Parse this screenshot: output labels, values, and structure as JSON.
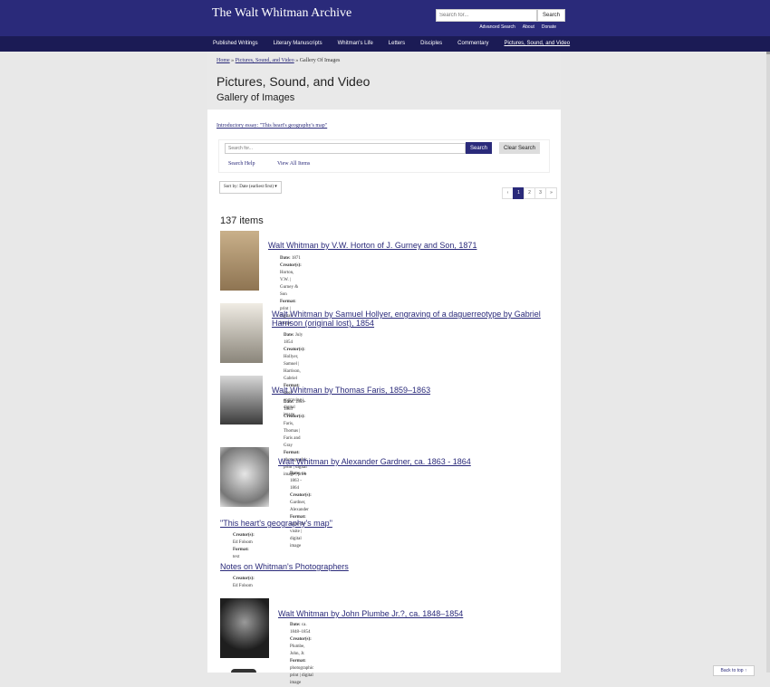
{
  "header": {
    "site_title": "The Walt Whitman Archive",
    "search_placeholder": "Search for...",
    "search_button": "Search",
    "links": [
      "Advanced Search",
      "About",
      "Donate"
    ]
  },
  "nav": {
    "items": [
      "Published Writings",
      "Literary Manuscripts",
      "Whitman's Life",
      "Letters",
      "Disciples",
      "Commentary",
      "Pictures, Sound, and Video"
    ]
  },
  "breadcrumb": {
    "home": "Home",
    "section": "Pictures, Sound, and Video",
    "current": "Gallery Of Images",
    "sep": "»"
  },
  "page": {
    "title": "Pictures, Sound, and Video",
    "subtitle": "Gallery of Images",
    "intro_link": "Introductory essay: \"This heart's geography's map\""
  },
  "search": {
    "placeholder": "Search for...",
    "search_button": "Search",
    "clear_button": "Clear Search",
    "help_link": "Search Help",
    "view_all_link": "View All Items"
  },
  "sort": {
    "label": "Sort by: Date (earliest first) ▾"
  },
  "pagination": {
    "prev": "‹",
    "pages": [
      "1",
      "2",
      "3"
    ],
    "next": "»"
  },
  "results": {
    "count": "137 items",
    "items": [
      {
        "title": "Walt Whitman by V.W. Horton of J. Gurney and Son, 1871",
        "date": "1871",
        "creator": "Horton, V.W. | Gurney & Son",
        "format": "print | digital image"
      },
      {
        "title": "Walt Whitman by Samuel Hollyer, engraving of a daguerreotype by Gabriel Harrison (original lost), 1854",
        "date": "July 1854",
        "creator": "Hollyer, Samuel | Harrison, Gabriel",
        "format": "steel engraving | digital image"
      },
      {
        "title": "Walt Whitman by Thomas Faris, 1859–1863",
        "date": "1859-1863",
        "creator": "Faris, Thomas | Faris and Gray",
        "format": "photographic print | digital image | print"
      },
      {
        "title": "Walt Whitman by Alexander Gardner, ca. 1863 - 1864",
        "date": "ca. 1863 - 1864",
        "creator": "Gardner, Alexander",
        "format": "carte-de-visite | digital image"
      },
      {
        "title": "\"This heart's geography's map\"",
        "creator": "Ed Folsom",
        "format": "text"
      },
      {
        "title": "Notes on Whitman's Photographers",
        "creator": "Ed Folsom"
      },
      {
        "title": "Walt Whitman by John Plumbe Jr.?, ca. 1848–1854",
        "date": "ca. 1848–1854",
        "creator": "Plumbe, John, Jr.",
        "format": "photographic print | digital image"
      }
    ]
  },
  "labels": {
    "date": "Date:",
    "creator": "Creator(s):",
    "format": "Format:"
  },
  "back_to_top": "Back to top ↑",
  "colors": {
    "brand": "#2a2a7a",
    "nav": "#1b1b55",
    "band": "#e9e9e9",
    "page_bg": "#e8e8e8"
  }
}
